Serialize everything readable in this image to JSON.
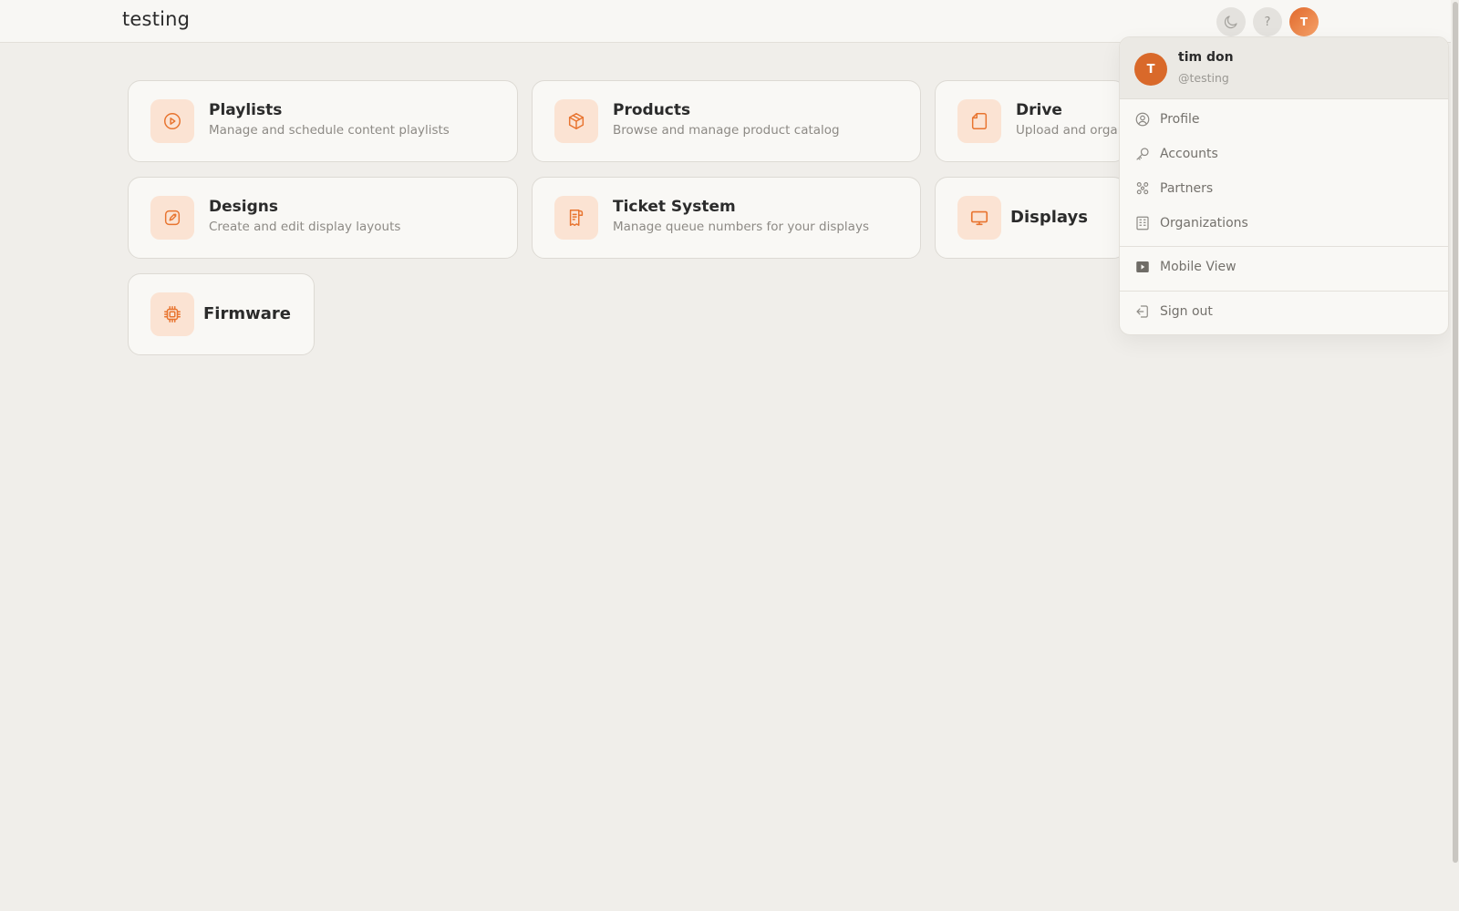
{
  "header": {
    "title": "testing",
    "help_label": "?",
    "avatar_initial": "T"
  },
  "cards": [
    {
      "title": "Playlists",
      "desc": "Manage and schedule content playlists"
    },
    {
      "title": "Products",
      "desc": "Browse and manage product catalog"
    },
    {
      "title": "Drive",
      "desc": "Upload and organize"
    },
    {
      "title": "Designs",
      "desc": "Create and edit display layouts"
    },
    {
      "title": "Ticket System",
      "desc": "Manage queue numbers for your displays"
    },
    {
      "title": "Displays"
    },
    {
      "title": "Firmware"
    }
  ],
  "user_menu": {
    "avatar_initial": "T",
    "name": "tim don",
    "handle": "@testing",
    "items": [
      {
        "label": "Profile",
        "icon": "user-circle-icon"
      },
      {
        "label": "Accounts",
        "icon": "key-icon"
      },
      {
        "label": "Partners",
        "icon": "partners-icon"
      },
      {
        "label": "Organizations",
        "icon": "building-icon"
      },
      {
        "label": "Mobile View",
        "icon": "play-square-icon"
      },
      {
        "label": "Sign out",
        "icon": "sign-out-icon"
      }
    ]
  },
  "colors": {
    "accent": "#e8742f",
    "icon_bg": "#fbe3d3",
    "page_bg": "#f0eeea"
  }
}
